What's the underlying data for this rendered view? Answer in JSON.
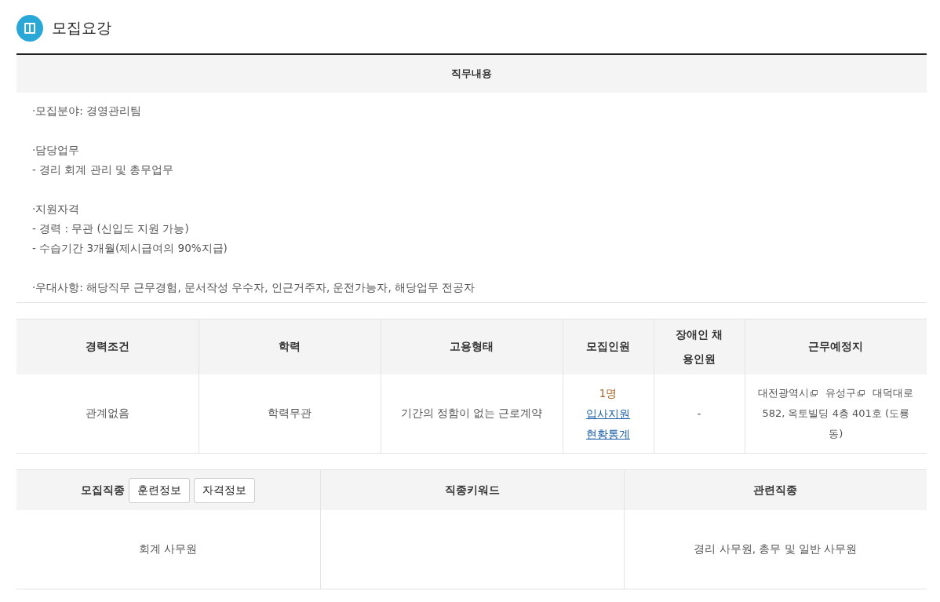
{
  "section": {
    "title": "모집요강"
  },
  "job_description": {
    "heading": "직무내용",
    "paragraphs": [
      [
        "·모집분야: 경영관리팀"
      ],
      [
        "·담당업무",
        " - 경리 회계 관리 및 총무업무"
      ],
      [
        "·지원자격",
        " - 경력 : 무관 (신입도 지원 가능)",
        " - 수습기간 3개월(제시급여의 90%지급)"
      ],
      [
        "·우대사항: 해당직무 근무경험, 문서작성 우수자, 인근거주자, 운전가능자, 해당업무 전공자"
      ]
    ]
  },
  "conditions": {
    "columns": [
      "경력조건",
      "학력",
      "고용형태",
      "모집인원",
      "장애인 채용인원",
      "근무예정지"
    ],
    "career": "관계없음",
    "education": "학력무관",
    "employment": "기간의 정함이 없는 근로계약",
    "headcount": {
      "count": "1명",
      "links": [
        "입사지원",
        "현황통계"
      ]
    },
    "disabled_headcount": "-",
    "location": [
      {
        "kind": "link",
        "text": "대전광역시"
      },
      {
        "kind": "link",
        "text": "유성구"
      },
      {
        "kind": "text",
        "text": "대덕대로 582, 옥토빌딩 4층 401호 (도룡동)"
      }
    ]
  },
  "occupation": {
    "columns": [
      {
        "label": "모집직종",
        "buttons": [
          "훈련정보",
          "자격정보"
        ],
        "value": "회계 사무원"
      },
      {
        "label": "직종키워드"
      },
      {
        "label": "관련직종",
        "value": "경리 사무원, 총무 및 일반 사무원"
      }
    ]
  }
}
